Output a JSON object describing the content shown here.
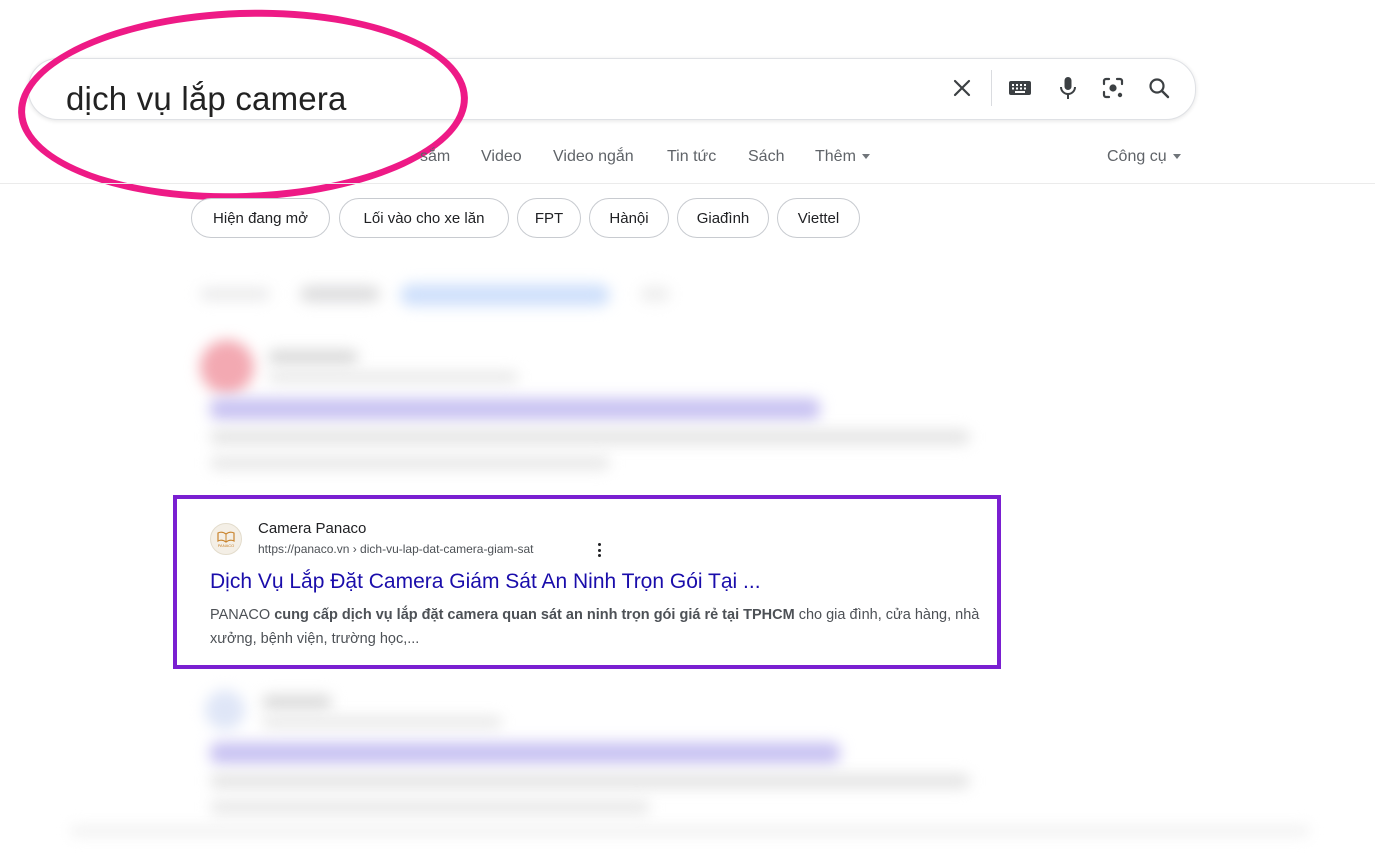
{
  "search": {
    "query": "dịch vụ lắp camera",
    "icons": [
      "clear-icon",
      "keyboard-icon",
      "microphone-icon",
      "lens-icon",
      "search-icon"
    ]
  },
  "tabs": [
    {
      "label": "sắm"
    },
    {
      "label": "Video"
    },
    {
      "label": "Video ngắn"
    },
    {
      "label": "Tin tức"
    },
    {
      "label": "Sách"
    },
    {
      "label": "Thêm"
    }
  ],
  "tools": {
    "label": "Công cụ"
  },
  "chips": [
    {
      "label": "Hiện đang mở"
    },
    {
      "label": "Lối vào cho xe lăn"
    },
    {
      "label": "FPT"
    },
    {
      "label": "Hànội"
    },
    {
      "label": "Giađình"
    },
    {
      "label": "Viettel"
    }
  ],
  "result": {
    "site_name": "Camera Panaco",
    "url": "https://panaco.vn › dich-vu-lap-dat-camera-giam-sat",
    "title": "Dịch Vụ Lắp Đặt Camera Giám Sát An Ninh Trọn Gói Tại ...",
    "favicon_text": "PANACO",
    "snippet": {
      "part1": "PANACO ",
      "bold1": "cung cấp dịch vụ lắp đặt camera quan sát an ninh trọn gói giá rẻ tại TPHCM",
      "part2": " cho gia đình, cửa hàng, nhà xưởng, bệnh viện, trường học,..."
    }
  },
  "colors": {
    "highlight_ellipse": "#ee1a86",
    "highlight_box": "#7a1fd1",
    "link": "#1a0dab"
  }
}
